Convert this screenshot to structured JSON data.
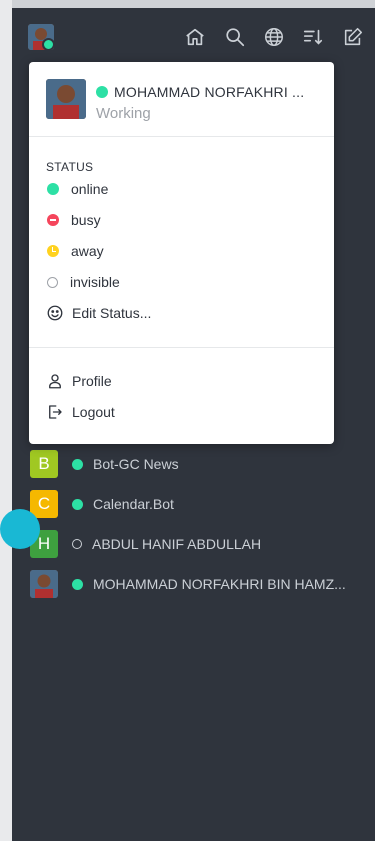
{
  "user": {
    "name": "MOHAMMAD NORFAKHRI ...",
    "status_text": "Working",
    "status_color": "#2de0a5"
  },
  "toolbar": {
    "icons": [
      "home-icon",
      "search-icon",
      "globe-icon",
      "sort-icon",
      "edit-icon"
    ]
  },
  "status_menu": {
    "heading": "STATUS",
    "items": [
      {
        "label": "online",
        "color": "#2de0a5"
      },
      {
        "label": "busy",
        "color": "#f5455c"
      },
      {
        "label": "away",
        "color": "#ffd21f"
      },
      {
        "label": "invisible",
        "color": "#9ea2a8"
      }
    ],
    "edit_label": "Edit Status...",
    "profile_label": "Profile",
    "logout_label": "Logout"
  },
  "contacts": [
    {
      "initial": "B",
      "name": "Bot-GC News",
      "status": "online",
      "avatar_color": "#a0c822"
    },
    {
      "initial": "C",
      "name": "Calendar.Bot",
      "status": "online",
      "avatar_color": "#f5b800"
    },
    {
      "initial": "H",
      "name": "ABDUL HANIF ABDULLAH",
      "status": "offline",
      "avatar_color": "#3ea03f"
    },
    {
      "initial": "",
      "name": "MOHAMMAD NORFAKHRI BIN HAMZ...",
      "status": "online",
      "avatar_color": "#8a5a45"
    }
  ]
}
